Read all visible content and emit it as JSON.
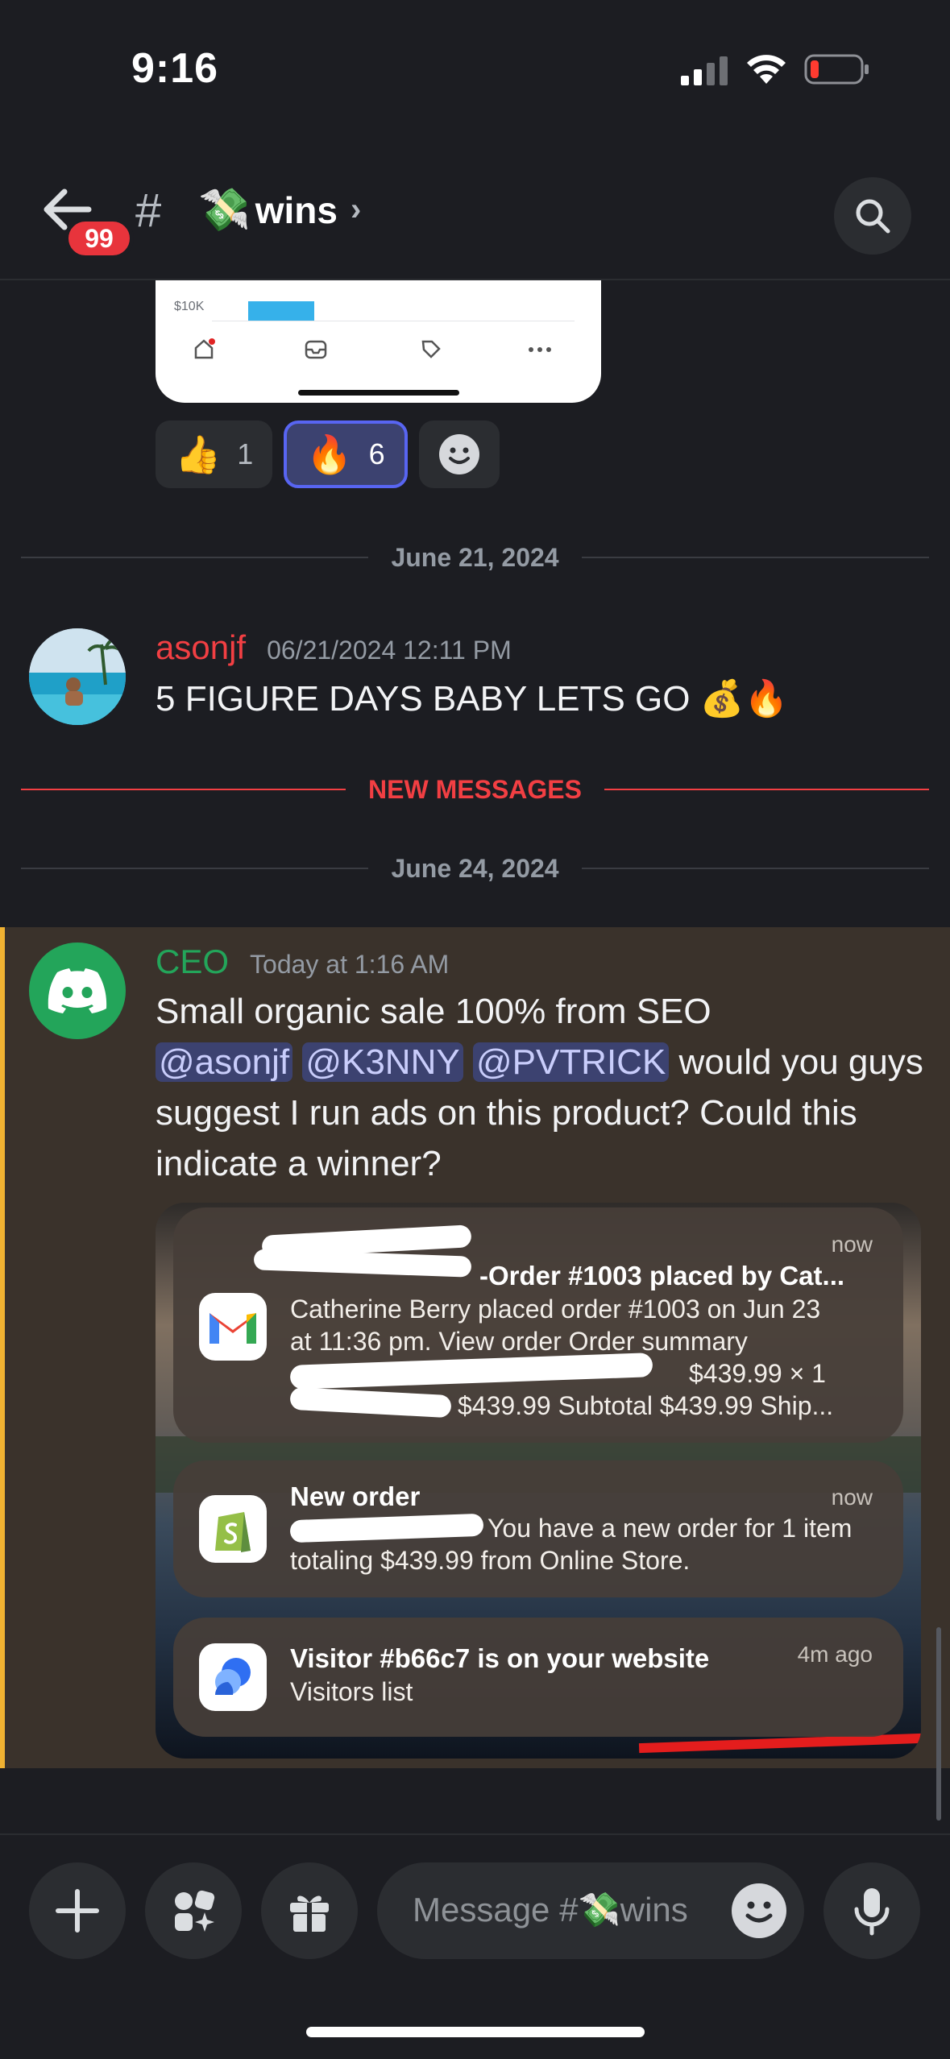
{
  "status_bar": {
    "time": "9:16"
  },
  "header": {
    "unread_badge": "99",
    "channel_hash": "#",
    "channel_emoji": "💸",
    "channel_name": "wins",
    "chevron": "›"
  },
  "attachment_top": {
    "axis_label": "$10K"
  },
  "reactions": [
    {
      "emoji": "👍",
      "count": "1",
      "active": false
    },
    {
      "emoji": "🔥",
      "count": "6",
      "active": true
    }
  ],
  "dividers": {
    "date1": "June 21, 2024",
    "new_messages": "NEW MESSAGES",
    "date2": "June 24, 2024"
  },
  "messages": [
    {
      "username": "asonjf",
      "username_color": "#f23f43",
      "timestamp": "06/21/2024 12:11 PM",
      "text": "5 FIGURE DAYS BABY LETS GO 💰🔥"
    },
    {
      "username": "CEO",
      "username_color": "#23a55a",
      "timestamp": "Today at 1:16 AM",
      "line1": "Small organic sale 100% from SEO",
      "mentions": [
        "@asonjf",
        "@K3NNY",
        "@PVTRICK"
      ],
      "line2_rest": " would you guys",
      "line3": "suggest I run ads on this product? Could this",
      "line4": "indicate a winner?"
    }
  ],
  "notifications": [
    {
      "app_icon": "gmail-icon",
      "time": "now",
      "title": "-Order #1003 placed by Cat...",
      "line1": "Catherine Berry placed order #1003 on Jun 23",
      "line2": "at 11:36 pm. View order Order summary",
      "line3": "$439.99 × 1",
      "line4": "$439.99 Subtotal $439.99 Ship..."
    },
    {
      "app_icon": "shopify-icon",
      "time": "now",
      "title": "New order",
      "line1": "You have a new order for 1 item",
      "line2": "totaling $439.99 from Online Store."
    },
    {
      "app_icon": "visitor-icon",
      "time": "4m ago",
      "title": "Visitor #b66c7 is on your website",
      "line1": "Visitors list"
    }
  ],
  "composer": {
    "placeholder": "Message #💸wins"
  }
}
